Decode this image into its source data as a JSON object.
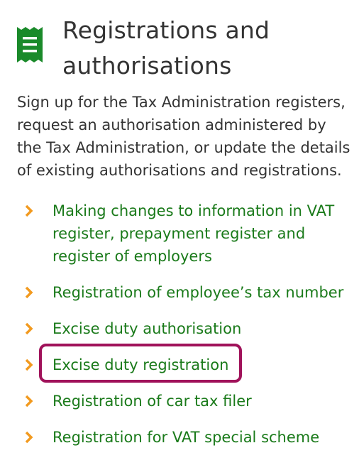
{
  "section": {
    "title": "Registrations and authorisations",
    "icon": "document-list-icon",
    "description": "Sign up for the Tax Administration registers, request an authorisation administered by the Tax Administration, or update the details of existing authorisations and registrations."
  },
  "links": [
    {
      "label": "Making changes to information in VAT register, prepayment register and register of employers"
    },
    {
      "label": "Registration of employee’s tax number"
    },
    {
      "label": "Excise duty authorisation"
    },
    {
      "label": "Excise duty registration"
    },
    {
      "label": "Registration of car tax filer"
    },
    {
      "label": "Registration for VAT special scheme"
    }
  ],
  "colors": {
    "link": "#1a7a1a",
    "icon": "#1a8a2a",
    "chevron": "#f29a1f",
    "highlight": "#a0125a",
    "text": "#333333"
  }
}
